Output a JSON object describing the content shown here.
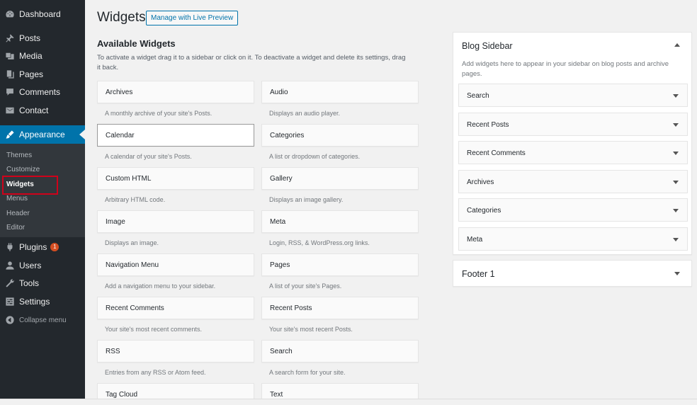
{
  "admin_menu": {
    "items": [
      {
        "label": "Dashboard",
        "icon": "dashboard-icon"
      },
      {
        "label": "Posts",
        "icon": "pin-icon"
      },
      {
        "label": "Media",
        "icon": "media-icon"
      },
      {
        "label": "Pages",
        "icon": "pages-icon"
      },
      {
        "label": "Comments",
        "icon": "comment-icon"
      },
      {
        "label": "Contact",
        "icon": "mail-icon"
      },
      {
        "label": "Appearance",
        "icon": "brush-icon"
      },
      {
        "label": "Plugins",
        "icon": "plugin-icon",
        "badge": "1"
      },
      {
        "label": "Users",
        "icon": "user-icon"
      },
      {
        "label": "Tools",
        "icon": "wrench-icon"
      },
      {
        "label": "Settings",
        "icon": "settings-icon"
      },
      {
        "label": "Collapse menu",
        "icon": "collapse-icon"
      }
    ],
    "submenu": [
      "Themes",
      "Customize",
      "Widgets",
      "Menus",
      "Header",
      "Editor"
    ]
  },
  "header": {
    "title": "Widgets",
    "live_preview_label": "Manage with Live Preview"
  },
  "available": {
    "title": "Available Widgets",
    "description": "To activate a widget drag it to a sidebar or click on it. To deactivate a widget and delete its settings, drag it back.",
    "widgets": [
      {
        "title": "Archives",
        "desc": "A monthly archive of your site's Posts."
      },
      {
        "title": "Audio",
        "desc": "Displays an audio player."
      },
      {
        "title": "Calendar",
        "desc": "A calendar of your site's Posts."
      },
      {
        "title": "Categories",
        "desc": "A list or dropdown of categories."
      },
      {
        "title": "Custom HTML",
        "desc": "Arbitrary HTML code."
      },
      {
        "title": "Gallery",
        "desc": "Displays an image gallery."
      },
      {
        "title": "Image",
        "desc": "Displays an image."
      },
      {
        "title": "Meta",
        "desc": "Login, RSS, & WordPress.org links."
      },
      {
        "title": "Navigation Menu",
        "desc": "Add a navigation menu to your sidebar."
      },
      {
        "title": "Pages",
        "desc": "A list of your site's Pages."
      },
      {
        "title": "Recent Comments",
        "desc": "Your site's most recent comments."
      },
      {
        "title": "Recent Posts",
        "desc": "Your site's most recent Posts."
      },
      {
        "title": "RSS",
        "desc": "Entries from any RSS or Atom feed."
      },
      {
        "title": "Search",
        "desc": "A search form for your site."
      },
      {
        "title": "Tag Cloud",
        "desc": ""
      },
      {
        "title": "Text",
        "desc": ""
      }
    ]
  },
  "blog_sidebar": {
    "title": "Blog Sidebar",
    "description": "Add widgets here to appear in your sidebar on blog posts and archive pages.",
    "widgets": [
      "Search",
      "Recent Posts",
      "Recent Comments",
      "Archives",
      "Categories",
      "Meta"
    ]
  },
  "footer1": {
    "title": "Footer 1"
  },
  "colors": {
    "sidebar_bg": "#23282d",
    "accent": "#0073aa",
    "highlight_border": "#d0021b"
  }
}
